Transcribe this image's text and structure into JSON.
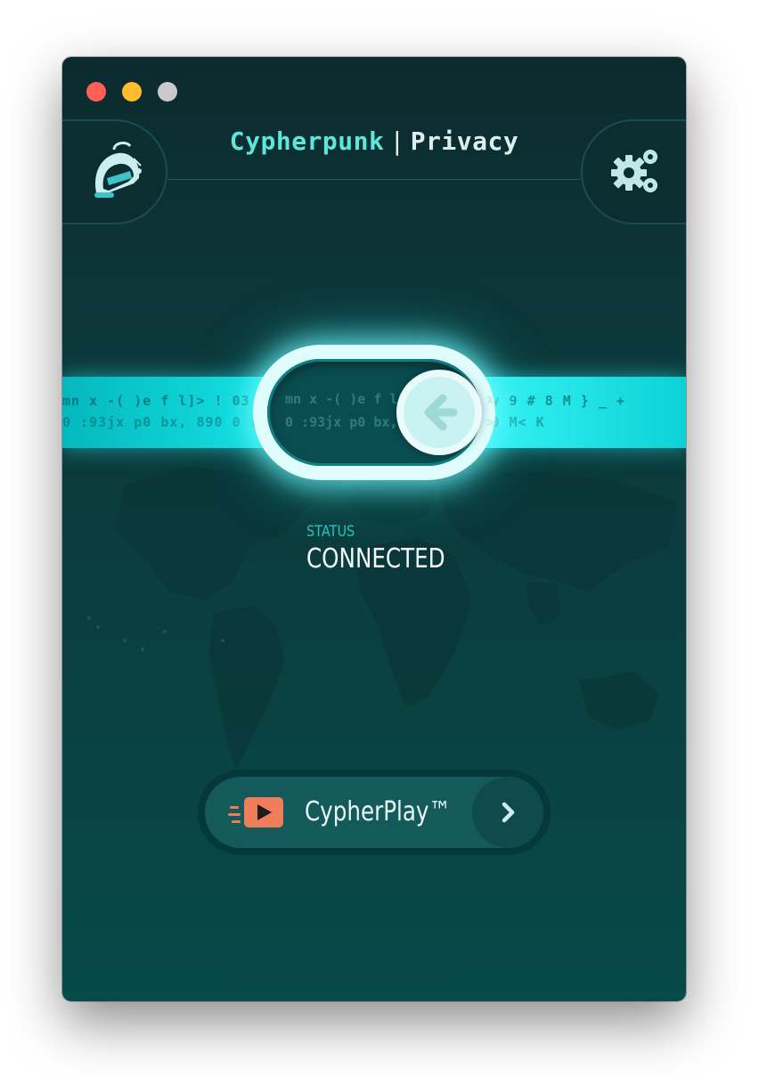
{
  "window": {
    "traffic_lights": [
      "close",
      "minimize",
      "zoom"
    ]
  },
  "header": {
    "title_part1": "Cypherpunk",
    "title_separator": "|",
    "title_part2": "Privacy",
    "left_icon": "cypherpunk-helmet-icon",
    "right_icon": "settings-gears-icon"
  },
  "connection": {
    "toggle_state": "on",
    "code_line_1": "mn x -( )e f l]> ! 03 @j   x-`.xl ty )[sx   7 mb\" l y 9 # 8 M } _ +",
    "code_line_2": "0 :93jx p0 bx, 890 0  ( \" >?7 9 3@ (      %%  u x 5 8 00 M< K",
    "status_label": "STATUS",
    "status_value": "CONNECTED"
  },
  "cypherplay": {
    "label": "CypherPlay™",
    "icon": "play-video-icon",
    "arrow_icon": "chevron-right-icon"
  },
  "colors": {
    "accent": "#5ee6da",
    "band": "#1af0f2",
    "background": "#0b3f3f",
    "status_label": "#25c5c0",
    "play_icon": "#ef7d5b"
  }
}
